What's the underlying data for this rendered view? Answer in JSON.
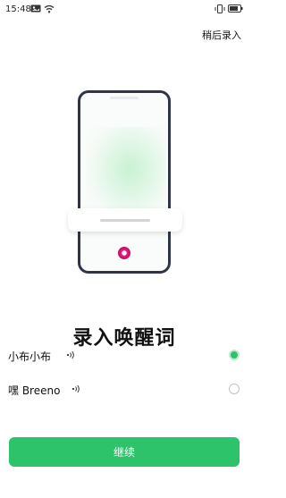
{
  "status_bar": {
    "time": "15:48",
    "icons": [
      "image-icon",
      "wifi-icon",
      "vibrate-icon",
      "battery-icon"
    ]
  },
  "header": {
    "action_label": "稍后录入"
  },
  "illustration": {
    "icon": "microphone-icon",
    "accent": "#e3157c"
  },
  "main": {
    "title": "录入唤醒词",
    "options": [
      {
        "label": "小布小布",
        "icon": "voice-icon",
        "selected": true
      },
      {
        "label": "嘿 Breeno",
        "icon": "voice-icon",
        "selected": false
      }
    ]
  },
  "footer": {
    "continue_label": "继续"
  },
  "colors": {
    "accent": "#2dc36a",
    "phone_frame": "#30344a"
  }
}
